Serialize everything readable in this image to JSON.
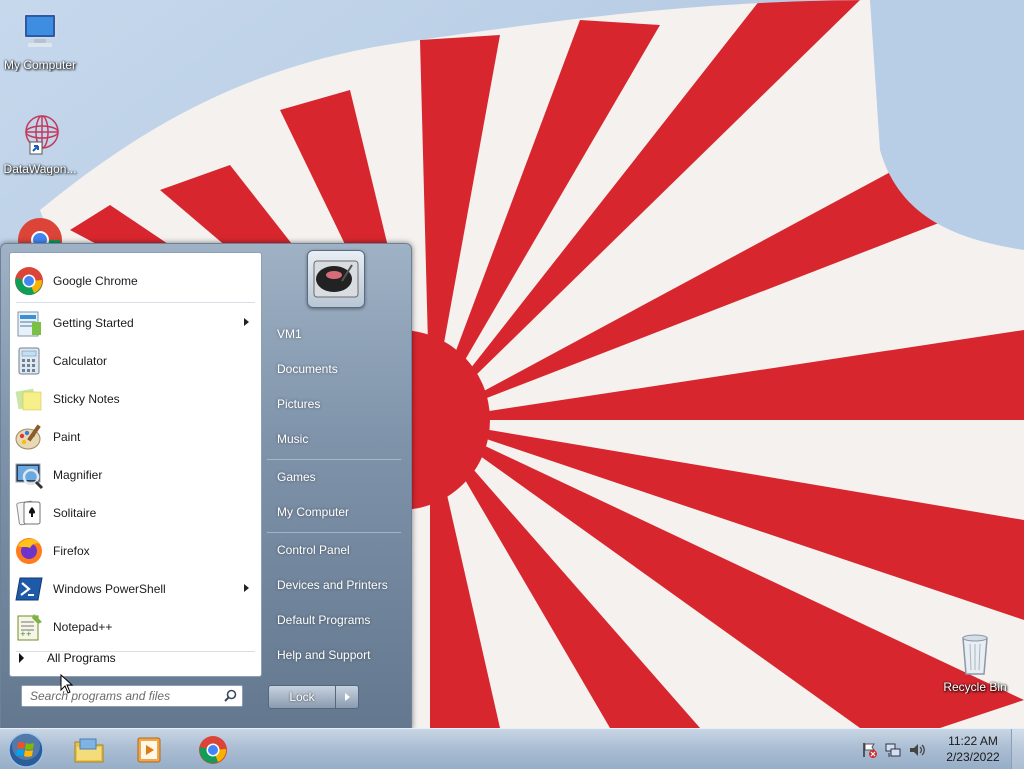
{
  "desktop": {
    "icons": [
      {
        "label": "My Computer"
      },
      {
        "label": "DataWagon..."
      },
      {
        "label": "Recycle Bin"
      }
    ]
  },
  "start_menu": {
    "pinned": [
      {
        "label": "Google Chrome",
        "icon": "chrome-icon",
        "has_submenu": false
      },
      {
        "label": "Getting Started",
        "icon": "getting-started-icon",
        "has_submenu": true
      },
      {
        "label": "Calculator",
        "icon": "calculator-icon",
        "has_submenu": false
      },
      {
        "label": "Sticky Notes",
        "icon": "sticky-notes-icon",
        "has_submenu": false
      },
      {
        "label": "Paint",
        "icon": "paint-icon",
        "has_submenu": false
      },
      {
        "label": "Magnifier",
        "icon": "magnifier-icon",
        "has_submenu": false
      },
      {
        "label": "Solitaire",
        "icon": "solitaire-icon",
        "has_submenu": false
      },
      {
        "label": "Firefox",
        "icon": "firefox-icon",
        "has_submenu": false
      },
      {
        "label": "Windows PowerShell",
        "icon": "powershell-icon",
        "has_submenu": true
      },
      {
        "label": "Notepad++",
        "icon": "notepadpp-icon",
        "has_submenu": false
      }
    ],
    "all_programs": "All Programs",
    "search_placeholder": "Search programs and files",
    "right_items": [
      "VM1",
      "Documents",
      "Pictures",
      "Music",
      "Games",
      "My Computer",
      "Control Panel",
      "Devices and Printers",
      "Default Programs",
      "Help and Support"
    ],
    "lock_label": "Lock"
  },
  "taskbar": {
    "pinned": [
      "explorer-icon",
      "media-player-icon",
      "chrome-icon"
    ],
    "time": "11:22 AM",
    "date": "2/23/2022"
  },
  "colors": {
    "flag_red": "#d8262e",
    "sky_blue": "#a9c3e0",
    "taskbar": "#a9bcd2"
  }
}
